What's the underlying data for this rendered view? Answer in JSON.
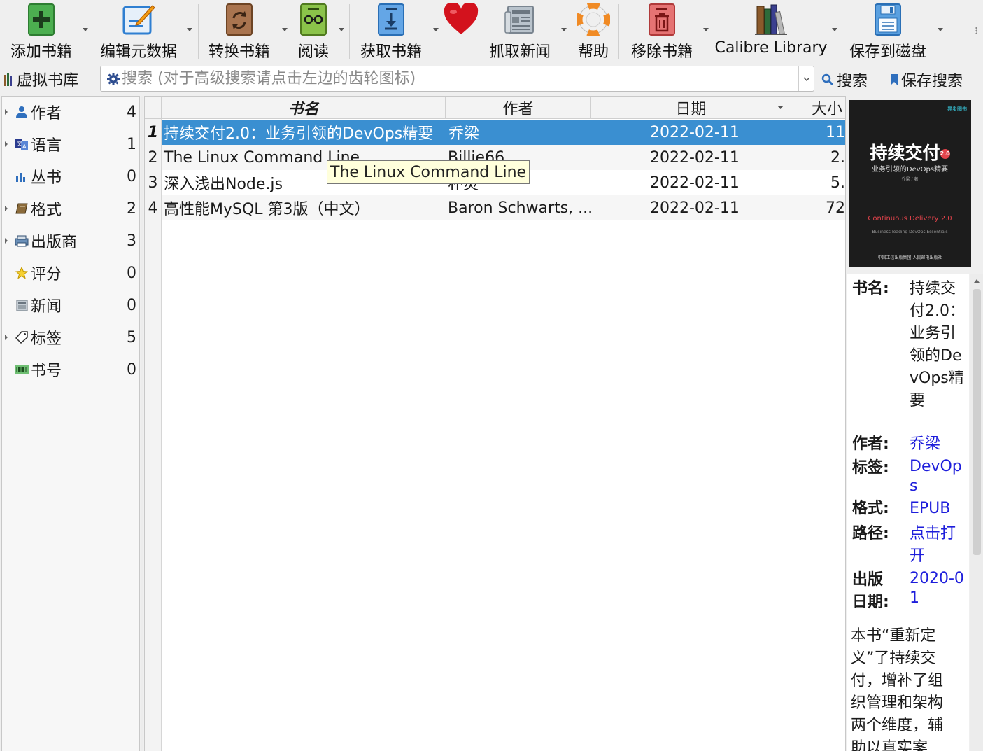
{
  "toolbar": {
    "add": "添加书籍",
    "edit": "编辑元数据",
    "convert": "转换书籍",
    "read": "阅读",
    "get": "获取书籍",
    "news": "抓取新闻",
    "help": "帮助",
    "remove": "移除书籍",
    "library": "Calibre Library",
    "save": "保存到磁盘"
  },
  "searchbar": {
    "virtual_library": "虚拟书库",
    "placeholder": "搜索 (对于高级搜索请点击左边的齿轮图标)",
    "search_button": "搜索",
    "save_search": "保存搜索"
  },
  "tag_browser": [
    {
      "label": "作者",
      "count": "4",
      "icon": "person-icon",
      "expandable": true
    },
    {
      "label": "语言",
      "count": "1",
      "icon": "language-icon",
      "expandable": true
    },
    {
      "label": "丛书",
      "count": "0",
      "icon": "series-icon",
      "expandable": false
    },
    {
      "label": "格式",
      "count": "2",
      "icon": "book-format-icon",
      "expandable": true
    },
    {
      "label": "出版商",
      "count": "3",
      "icon": "publisher-icon",
      "expandable": true
    },
    {
      "label": "评分",
      "count": "0",
      "icon": "star-icon",
      "expandable": false
    },
    {
      "label": "新闻",
      "count": "0",
      "icon": "news-icon",
      "expandable": false
    },
    {
      "label": "标签",
      "count": "5",
      "icon": "tag-icon",
      "expandable": true
    },
    {
      "label": "书号",
      "count": "0",
      "icon": "barcode-icon",
      "expandable": false
    }
  ],
  "book_list": {
    "columns": {
      "title": "书名",
      "author": "作者",
      "date": "日期",
      "size": "大小"
    },
    "rows": [
      {
        "num": "1",
        "title": "持续交付2.0：业务引领的DevOps精要",
        "author": "乔梁",
        "date": "2022-02-11",
        "size": "11"
      },
      {
        "num": "2",
        "title": "The Linux Command Line",
        "author": "Billie66",
        "date": "2022-02-11",
        "size": "2."
      },
      {
        "num": "3",
        "title": "深入浅出Node.js",
        "author": "朴灵",
        "date": "2022-02-11",
        "size": "5."
      },
      {
        "num": "4",
        "title": "高性能MySQL 第3版（中文）",
        "author": "Baron Schwarts, ...",
        "date": "2022-02-11",
        "size": "72"
      }
    ],
    "tooltip": "The Linux Command Line"
  },
  "details": {
    "cover": {
      "title": "持续交付",
      "badge": "2.0",
      "subtitle": "业务引领的DevOps精要",
      "author": "乔梁 / 著",
      "en_title": "Continuous Delivery 2.0",
      "en_subtitle": "Business-leading DevOps Essentials",
      "publishers": "中国工信出版集团  人民邮电出版社",
      "logo": "异步图书"
    },
    "title_label": "书名:",
    "title_value": "持续交付2.0：业务引领的DevOps精要",
    "author_label": "作者:",
    "author_value": "乔梁",
    "tags_label": "标签:",
    "tags_value": "DevOps",
    "format_label": "格式:",
    "format_value": "EPUB",
    "path_label": "路径:",
    "path_value": "点击打开",
    "pubdate_label": "出版日期:",
    "pubdate_value": "2020-01",
    "comments": "本书“重新定义”了持续交付，增补了组织管理和架构两个维度，辅助以真实案"
  }
}
